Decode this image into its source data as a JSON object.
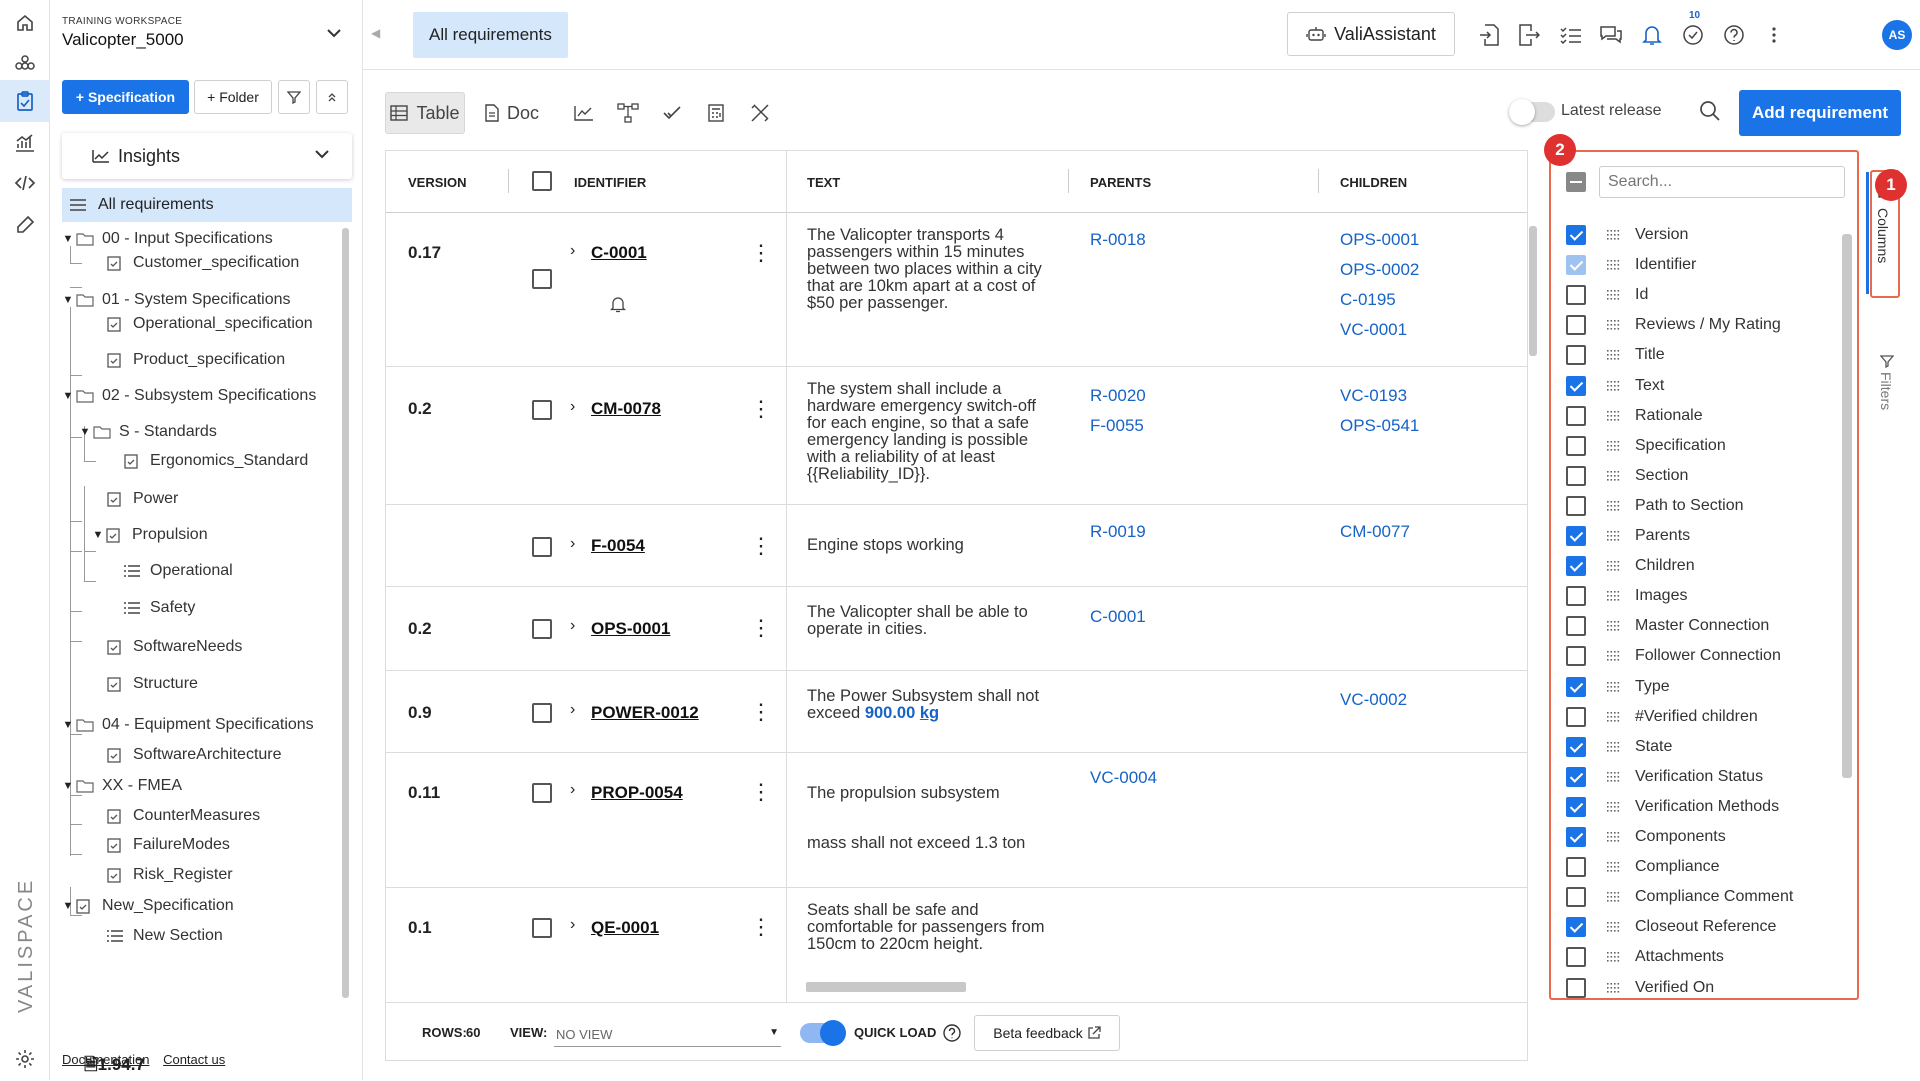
{
  "workspace": {
    "label": "TRAINING WORKSPACE",
    "name": "Valicopter_5000"
  },
  "sidebar": {
    "spec_button": "+ Specification",
    "folder_button": "+ Folder",
    "insights": "Insights",
    "all_requirements": "All requirements",
    "tree": [
      {
        "label": "00 - Input Specifications",
        "type": "folder"
      },
      {
        "label": "Customer_specification",
        "type": "spec"
      },
      {
        "label": "01 - System Specifications",
        "type": "folder"
      },
      {
        "label": "Operational_specification",
        "type": "spec"
      },
      {
        "label": "Product_specification",
        "type": "spec"
      },
      {
        "label": "02 - Subsystem Specifications",
        "type": "folder"
      },
      {
        "label": "S - Standards",
        "type": "folder"
      },
      {
        "label": "Ergonomics_Standard",
        "type": "spec"
      },
      {
        "label": "Power",
        "type": "spec"
      },
      {
        "label": "Propulsion",
        "type": "spec"
      },
      {
        "label": "Operational",
        "type": "section"
      },
      {
        "label": "Safety",
        "type": "section"
      },
      {
        "label": "SoftwareNeeds",
        "type": "spec"
      },
      {
        "label": "Structure",
        "type": "spec"
      },
      {
        "label": "04 - Equipment Specifications",
        "type": "folder"
      },
      {
        "label": "SoftwareArchitecture",
        "type": "spec"
      },
      {
        "label": "XX - FMEA",
        "type": "folder"
      },
      {
        "label": "CounterMeasures",
        "type": "spec"
      },
      {
        "label": "FailureModes",
        "type": "spec"
      },
      {
        "label": "Risk_Register",
        "type": "spec"
      },
      {
        "label": "New_Specification",
        "type": "spec"
      },
      {
        "label": "New Section",
        "type": "section"
      }
    ],
    "footer": {
      "documentation": "Documentation",
      "contact": "Contact us",
      "version": "1.94.7"
    }
  },
  "topbar": {
    "tab": "All requirements",
    "assistant": "ValiAssistant",
    "notifications": "10",
    "avatar": "AS"
  },
  "viewbar": {
    "table": "Table",
    "doc": "Doc",
    "latest_release": "Latest release",
    "add_requirement": "Add requirement"
  },
  "grid": {
    "headers": {
      "version": "VERSION",
      "identifier": "IDENTIFIER",
      "text": "TEXT",
      "parents": "PARENTS",
      "children": "CHILDREN"
    },
    "rows": [
      {
        "version": "0.17",
        "id": "C-0001",
        "text": "The Valicopter transports 4 passengers within 15 minutes between two places within a city that are 10km apart at a cost of $50 per passenger.",
        "parents": [
          "R-0018"
        ],
        "children": [
          "OPS-0001",
          "OPS-0002",
          "C-0195",
          "VC-0001"
        ]
      },
      {
        "version": "0.2",
        "id": "CM-0078",
        "text": "The system shall include a hardware emergency switch-off for each engine, so that a safe emergency landing is possible with a reliability of at least {{Reliability_ID}}.",
        "parents": [
          "R-0020",
          "F-0055"
        ],
        "children": [
          "VC-0193",
          "OPS-0541"
        ]
      },
      {
        "version": "",
        "id": "F-0054",
        "text": "Engine stops working",
        "parents": [
          "R-0019"
        ],
        "children": [
          "CM-0077"
        ]
      },
      {
        "version": "0.2",
        "id": "OPS-0001",
        "text": "The Valicopter shall be able to operate in cities.",
        "parents": [
          "C-0001"
        ],
        "children": []
      },
      {
        "version": "0.9",
        "id": "POWER-0012",
        "text": "The Power Subsystem shall not exceed",
        "value": "900.00",
        "unit": "kg",
        "parents": [],
        "children": [
          "VC-0002"
        ]
      },
      {
        "version": "0.11",
        "id": "PROP-0054",
        "text": "The propulsion subsystem",
        "text2": "mass shall not exceed 1.3 ton",
        "parents": [
          "VC-0004"
        ],
        "children": []
      },
      {
        "version": "0.1",
        "id": "QE-0001",
        "text": "Seats shall be safe and comfortable for passengers from 150cm to 220cm height.",
        "parents": [],
        "children": []
      }
    ]
  },
  "footer": {
    "rows_label": "ROWS:",
    "rows": "60",
    "view_label": "VIEW:",
    "view": "NO VIEW",
    "quick_load": "QUICK LOAD",
    "beta": "Beta feedback"
  },
  "columns_panel": {
    "search_placeholder": "Search...",
    "items": [
      {
        "label": "Version",
        "checked": true
      },
      {
        "label": "Identifier",
        "checked": true,
        "disabled": true
      },
      {
        "label": "Id",
        "checked": false
      },
      {
        "label": "Reviews / My Rating",
        "checked": false
      },
      {
        "label": "Title",
        "checked": false
      },
      {
        "label": "Text",
        "checked": true
      },
      {
        "label": "Rationale",
        "checked": false
      },
      {
        "label": "Specification",
        "checked": false
      },
      {
        "label": "Section",
        "checked": false
      },
      {
        "label": "Path to Section",
        "checked": false
      },
      {
        "label": "Parents",
        "checked": true
      },
      {
        "label": "Children",
        "checked": true
      },
      {
        "label": "Images",
        "checked": false
      },
      {
        "label": "Master Connection",
        "checked": false
      },
      {
        "label": "Follower Connection",
        "checked": false
      },
      {
        "label": "Type",
        "checked": true
      },
      {
        "label": "#Verified children",
        "checked": false
      },
      {
        "label": "State",
        "checked": true
      },
      {
        "label": "Verification Status",
        "checked": true
      },
      {
        "label": "Verification Methods",
        "checked": true
      },
      {
        "label": "Components",
        "checked": true
      },
      {
        "label": "Compliance",
        "checked": false
      },
      {
        "label": "Compliance Comment",
        "checked": false
      },
      {
        "label": "Closeout Reference",
        "checked": true
      },
      {
        "label": "Attachments",
        "checked": false
      },
      {
        "label": "Verified On",
        "checked": false
      }
    ]
  },
  "side_tabs": {
    "columns": "Columns",
    "filters": "Filters"
  },
  "annotations": [
    "1",
    "2"
  ],
  "logo_text": "VALISPACE",
  "colors": {
    "accent": "#1a74e8",
    "link": "#1763c6",
    "highlight": "#e86a4a",
    "marker": "#e03131",
    "selected_bg": "#d4e7fb"
  }
}
